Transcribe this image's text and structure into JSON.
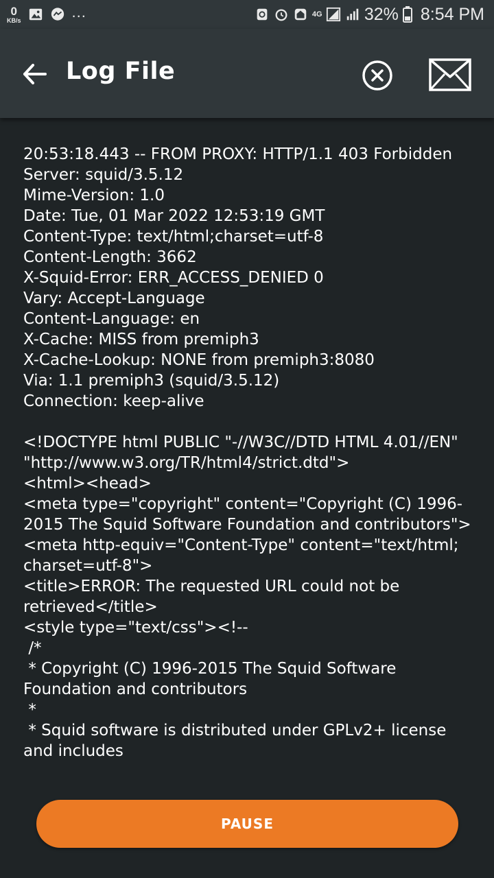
{
  "status_bar": {
    "speed_value": "0",
    "speed_unit": "KB/s",
    "overflow": "...",
    "network": "4G",
    "battery_percent": "32%",
    "time": "8:54 PM"
  },
  "app_bar": {
    "title": "Log File",
    "icons": [
      "arrow-back-icon",
      "clear-circle-icon",
      "mail-icon"
    ]
  },
  "log": {
    "lines": [
      "20:53:18.443 -- FROM PROXY: HTTP/1.1 403 Forbidden",
      "Server: squid/3.5.12",
      "Mime-Version: 1.0",
      "Date: Tue, 01 Mar 2022 12:53:19 GMT",
      "Content-Type: text/html;charset=utf-8",
      "Content-Length: 3662",
      "X-Squid-Error: ERR_ACCESS_DENIED 0",
      "Vary: Accept-Language",
      "Content-Language: en",
      "X-Cache: MISS from premiph3",
      "X-Cache-Lookup: NONE from premiph3:8080",
      "Via: 1.1 premiph3 (squid/3.5.12)",
      "Connection: keep-alive",
      "",
      "<!DOCTYPE html PUBLIC \"-//W3C//DTD HTML 4.01//EN\" \"http://www.w3.org/TR/html4/strict.dtd\">",
      "<html><head>",
      "<meta type=\"copyright\" content=\"Copyright (C) 1996-2015 The Squid Software Foundation and contributors\">",
      "<meta http-equiv=\"Content-Type\" content=\"text/html; charset=utf-8\">",
      "<title>ERROR: The requested URL could not be retrieved</title>",
      "<style type=\"text/css\"><!--",
      " /*",
      " * Copyright (C) 1996-2015 The Squid Software Foundation and contributors",
      " *",
      " * Squid software is distributed under GPLv2+ license and includes"
    ]
  },
  "pause_button": {
    "label": "PAUSE"
  },
  "colors": {
    "accent": "#ec7a24",
    "app_bar": "#30373a",
    "background": "#1f2426"
  }
}
